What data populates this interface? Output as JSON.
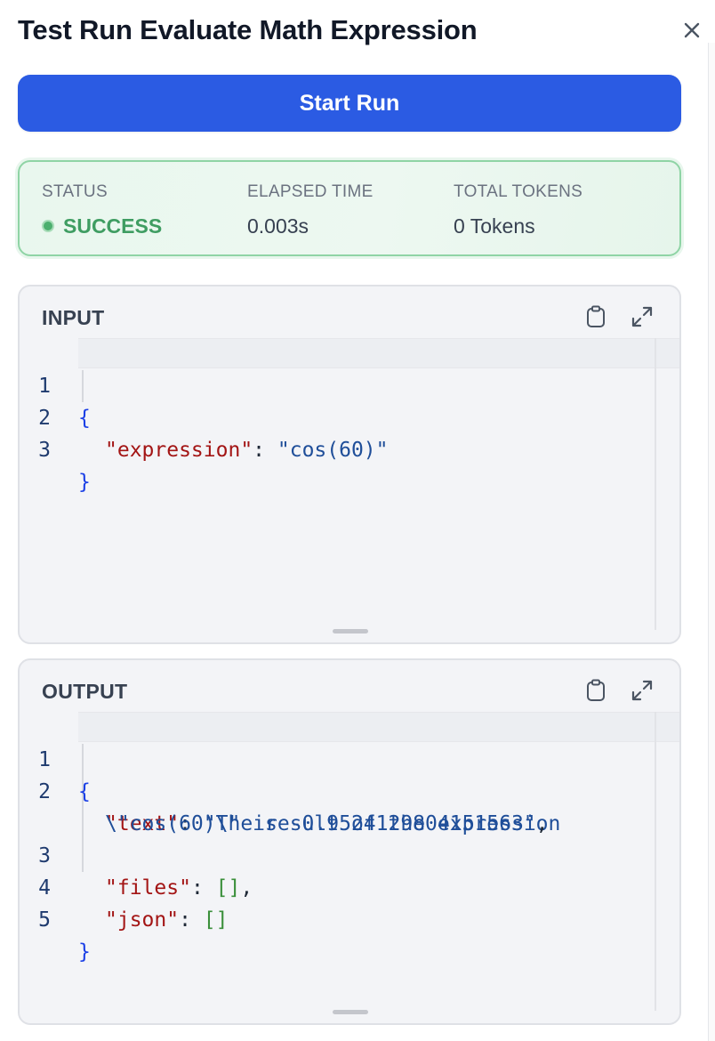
{
  "header": {
    "title": "Test Run Evaluate Math Expression",
    "close_icon": "close-icon"
  },
  "run_button": {
    "label": "Start Run"
  },
  "status": {
    "status_label": "STATUS",
    "status_value": "SUCCESS",
    "elapsed_label": "ELAPSED TIME",
    "elapsed_value": "0.003s",
    "tokens_label": "TOTAL TOKENS",
    "tokens_value": "0 Tokens",
    "success_color": "#3f9d62"
  },
  "input_panel": {
    "title": "INPUT",
    "copy_icon": "clipboard-icon",
    "expand_icon": "expand-icon",
    "line_numbers": [
      "1",
      "2",
      "3"
    ],
    "lines": [
      {
        "open": "{"
      },
      {
        "key": "\"expression\"",
        "sep": ": ",
        "value": "\"cos(60)\""
      },
      {
        "close": "}"
      }
    ]
  },
  "output_panel": {
    "title": "OUTPUT",
    "copy_icon": "clipboard-icon",
    "expand_icon": "expand-icon",
    "line_numbers": [
      "1",
      "2",
      "3",
      "4",
      "5"
    ],
    "lines": [
      {
        "open": "{"
      },
      {
        "key": "\"text\"",
        "sep": ": ",
        "value_part1": "\"The result of the expression",
        "value_part2": "\\\"cos(60)\\\" is -0.9524129804151563\"",
        "trail": ","
      },
      {
        "key": "\"files\"",
        "sep": ": ",
        "value": "[]",
        "trail": ","
      },
      {
        "key": "\"json\"",
        "sep": ": ",
        "value": "[]"
      },
      {
        "close": "}"
      }
    ]
  }
}
